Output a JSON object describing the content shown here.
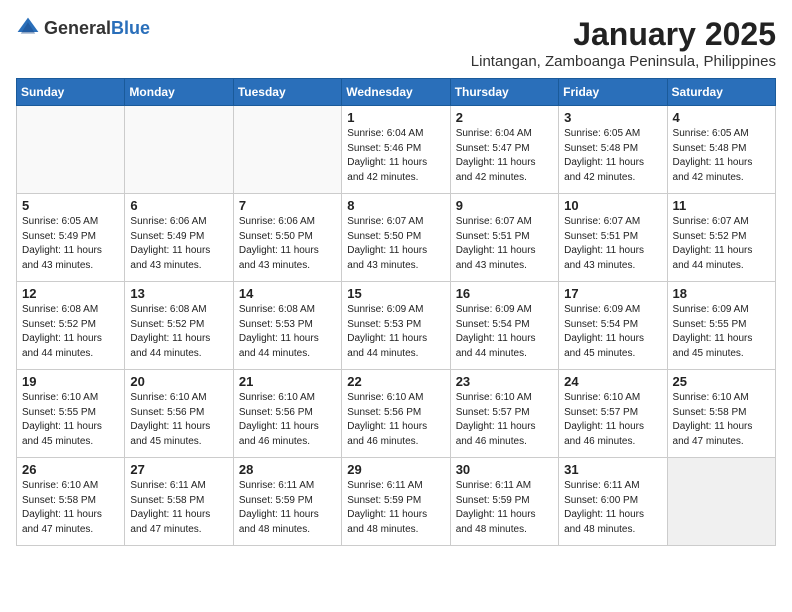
{
  "logo": {
    "general": "General",
    "blue": "Blue"
  },
  "title": "January 2025",
  "location": "Lintangan, Zamboanga Peninsula, Philippines",
  "weekdays": [
    "Sunday",
    "Monday",
    "Tuesday",
    "Wednesday",
    "Thursday",
    "Friday",
    "Saturday"
  ],
  "weeks": [
    [
      {
        "day": "",
        "info": ""
      },
      {
        "day": "",
        "info": ""
      },
      {
        "day": "",
        "info": ""
      },
      {
        "day": "1",
        "info": "Sunrise: 6:04 AM\nSunset: 5:46 PM\nDaylight: 11 hours\nand 42 minutes."
      },
      {
        "day": "2",
        "info": "Sunrise: 6:04 AM\nSunset: 5:47 PM\nDaylight: 11 hours\nand 42 minutes."
      },
      {
        "day": "3",
        "info": "Sunrise: 6:05 AM\nSunset: 5:48 PM\nDaylight: 11 hours\nand 42 minutes."
      },
      {
        "day": "4",
        "info": "Sunrise: 6:05 AM\nSunset: 5:48 PM\nDaylight: 11 hours\nand 42 minutes."
      }
    ],
    [
      {
        "day": "5",
        "info": "Sunrise: 6:05 AM\nSunset: 5:49 PM\nDaylight: 11 hours\nand 43 minutes."
      },
      {
        "day": "6",
        "info": "Sunrise: 6:06 AM\nSunset: 5:49 PM\nDaylight: 11 hours\nand 43 minutes."
      },
      {
        "day": "7",
        "info": "Sunrise: 6:06 AM\nSunset: 5:50 PM\nDaylight: 11 hours\nand 43 minutes."
      },
      {
        "day": "8",
        "info": "Sunrise: 6:07 AM\nSunset: 5:50 PM\nDaylight: 11 hours\nand 43 minutes."
      },
      {
        "day": "9",
        "info": "Sunrise: 6:07 AM\nSunset: 5:51 PM\nDaylight: 11 hours\nand 43 minutes."
      },
      {
        "day": "10",
        "info": "Sunrise: 6:07 AM\nSunset: 5:51 PM\nDaylight: 11 hours\nand 43 minutes."
      },
      {
        "day": "11",
        "info": "Sunrise: 6:07 AM\nSunset: 5:52 PM\nDaylight: 11 hours\nand 44 minutes."
      }
    ],
    [
      {
        "day": "12",
        "info": "Sunrise: 6:08 AM\nSunset: 5:52 PM\nDaylight: 11 hours\nand 44 minutes."
      },
      {
        "day": "13",
        "info": "Sunrise: 6:08 AM\nSunset: 5:52 PM\nDaylight: 11 hours\nand 44 minutes."
      },
      {
        "day": "14",
        "info": "Sunrise: 6:08 AM\nSunset: 5:53 PM\nDaylight: 11 hours\nand 44 minutes."
      },
      {
        "day": "15",
        "info": "Sunrise: 6:09 AM\nSunset: 5:53 PM\nDaylight: 11 hours\nand 44 minutes."
      },
      {
        "day": "16",
        "info": "Sunrise: 6:09 AM\nSunset: 5:54 PM\nDaylight: 11 hours\nand 44 minutes."
      },
      {
        "day": "17",
        "info": "Sunrise: 6:09 AM\nSunset: 5:54 PM\nDaylight: 11 hours\nand 45 minutes."
      },
      {
        "day": "18",
        "info": "Sunrise: 6:09 AM\nSunset: 5:55 PM\nDaylight: 11 hours\nand 45 minutes."
      }
    ],
    [
      {
        "day": "19",
        "info": "Sunrise: 6:10 AM\nSunset: 5:55 PM\nDaylight: 11 hours\nand 45 minutes."
      },
      {
        "day": "20",
        "info": "Sunrise: 6:10 AM\nSunset: 5:56 PM\nDaylight: 11 hours\nand 45 minutes."
      },
      {
        "day": "21",
        "info": "Sunrise: 6:10 AM\nSunset: 5:56 PM\nDaylight: 11 hours\nand 46 minutes."
      },
      {
        "day": "22",
        "info": "Sunrise: 6:10 AM\nSunset: 5:56 PM\nDaylight: 11 hours\nand 46 minutes."
      },
      {
        "day": "23",
        "info": "Sunrise: 6:10 AM\nSunset: 5:57 PM\nDaylight: 11 hours\nand 46 minutes."
      },
      {
        "day": "24",
        "info": "Sunrise: 6:10 AM\nSunset: 5:57 PM\nDaylight: 11 hours\nand 46 minutes."
      },
      {
        "day": "25",
        "info": "Sunrise: 6:10 AM\nSunset: 5:58 PM\nDaylight: 11 hours\nand 47 minutes."
      }
    ],
    [
      {
        "day": "26",
        "info": "Sunrise: 6:10 AM\nSunset: 5:58 PM\nDaylight: 11 hours\nand 47 minutes."
      },
      {
        "day": "27",
        "info": "Sunrise: 6:11 AM\nSunset: 5:58 PM\nDaylight: 11 hours\nand 47 minutes."
      },
      {
        "day": "28",
        "info": "Sunrise: 6:11 AM\nSunset: 5:59 PM\nDaylight: 11 hours\nand 48 minutes."
      },
      {
        "day": "29",
        "info": "Sunrise: 6:11 AM\nSunset: 5:59 PM\nDaylight: 11 hours\nand 48 minutes."
      },
      {
        "day": "30",
        "info": "Sunrise: 6:11 AM\nSunset: 5:59 PM\nDaylight: 11 hours\nand 48 minutes."
      },
      {
        "day": "31",
        "info": "Sunrise: 6:11 AM\nSunset: 6:00 PM\nDaylight: 11 hours\nand 48 minutes."
      },
      {
        "day": "",
        "info": ""
      }
    ]
  ]
}
